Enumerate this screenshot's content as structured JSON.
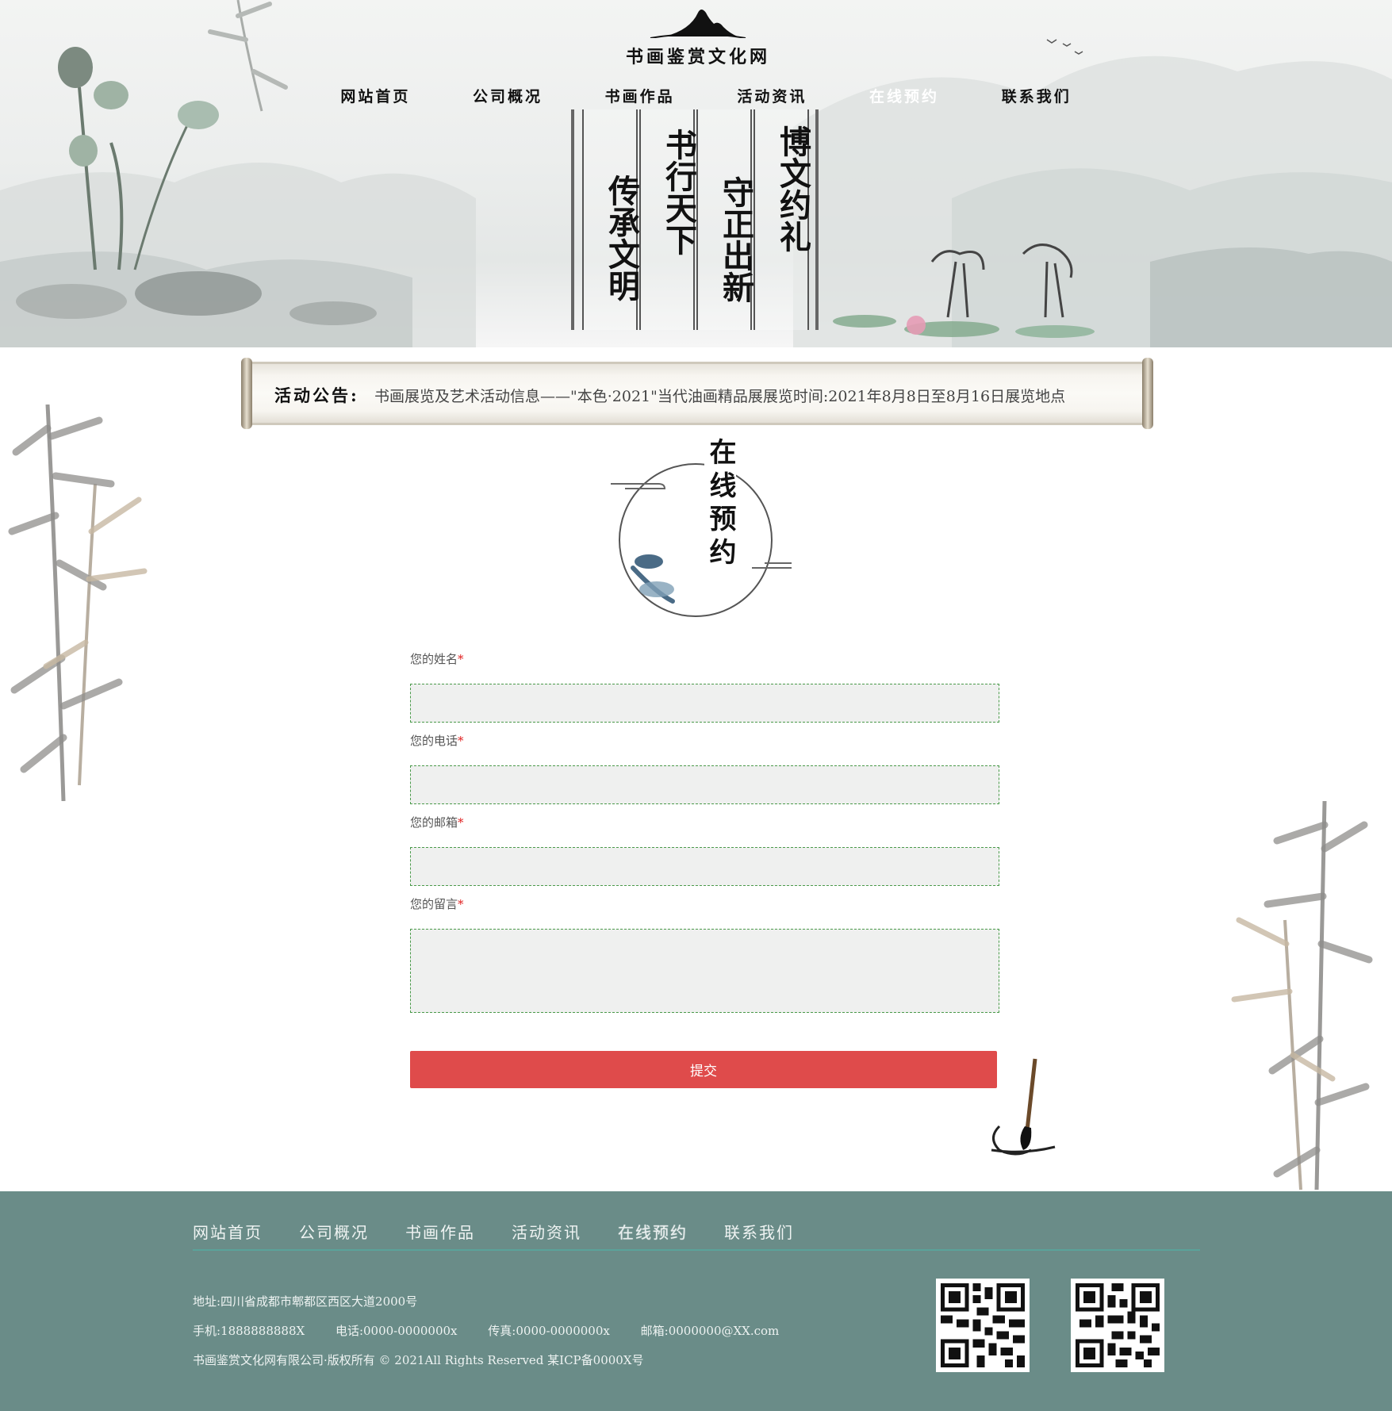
{
  "site": {
    "logo_title": "书画鉴赏文化网"
  },
  "nav": {
    "items": [
      {
        "label": "网站首页"
      },
      {
        "label": "公司概况"
      },
      {
        "label": "书画作品"
      },
      {
        "label": "活动资讯"
      },
      {
        "label": "在线预约",
        "active": true
      },
      {
        "label": "联系我们"
      }
    ]
  },
  "banner": {
    "couplets": [
      "传承文明",
      "书行天下",
      "守正出新",
      "博文约礼"
    ]
  },
  "notice": {
    "label": "活动公告:",
    "text": "书画展览及艺术活动信息——\"本色·2021\"当代油画精品展展览时间:2021年8月8日至8月16日展览地点"
  },
  "section": {
    "title": "在线预约"
  },
  "form": {
    "fields": [
      {
        "label": "您的姓名",
        "required_mark": "*",
        "value": ""
      },
      {
        "label": "您的电话",
        "required_mark": "*",
        "value": ""
      },
      {
        "label": "您的邮箱",
        "required_mark": "*",
        "value": ""
      },
      {
        "label": "您的留言",
        "required_mark": "*",
        "value": ""
      }
    ],
    "submit_label": "提交"
  },
  "footer": {
    "nav": [
      "网站首页",
      "公司概况",
      "书画作品",
      "活动资讯",
      "在线预约",
      "联系我们"
    ],
    "address": "地址:四川省成都市郫都区西区大道2000号",
    "mobile": "手机:1888888888X",
    "phone": "电话:0000-0000000x",
    "fax": "传真:0000-0000000x",
    "email": "邮箱:0000000@XX.com",
    "copyright": "书画鉴赏文化网有限公司·版权所有 © 2021All Rights Reserved 某ICP备0000X号"
  },
  "colors": {
    "accent": "#df4b4b",
    "footer_bg": "#6a8c88",
    "footer_divider": "#5aa39a",
    "input_border": "#4a9a4a"
  }
}
